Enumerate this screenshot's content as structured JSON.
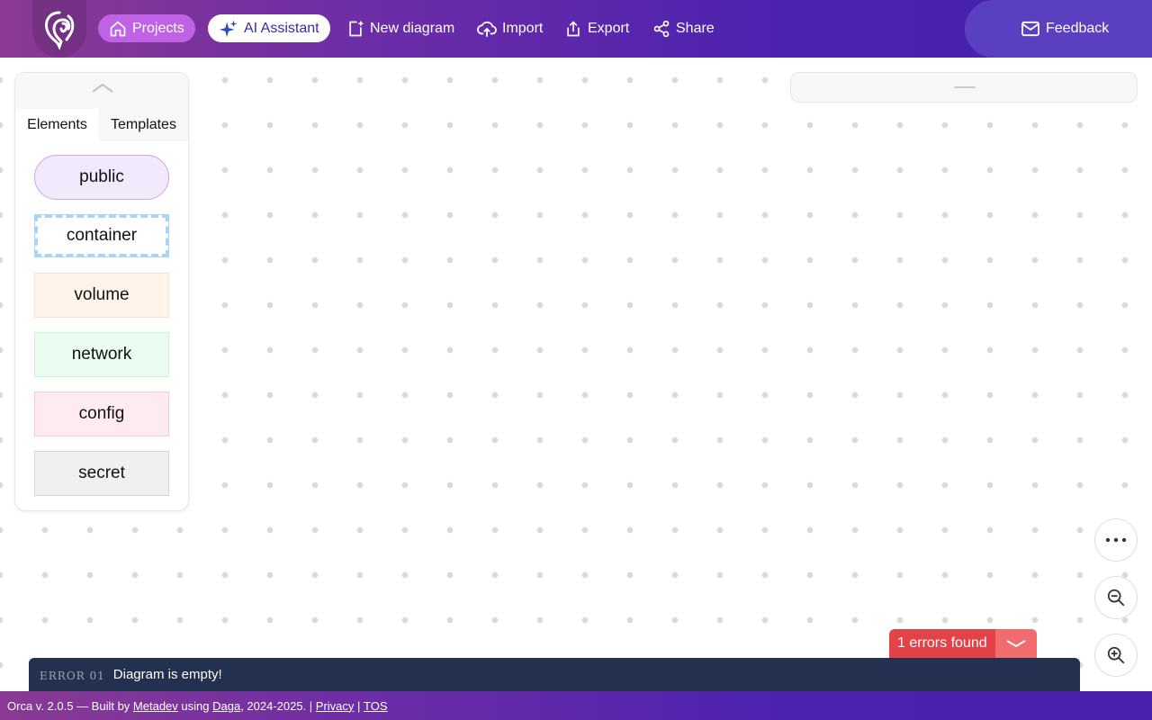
{
  "topbar": {
    "logo_icon": "ram-head-logo-icon",
    "projects_label": "Projects",
    "ai_label": "AI Assistant",
    "new_label": "New diagram",
    "import_label": "Import",
    "export_label": "Export",
    "share_label": "Share",
    "feedback_label": "Feedback"
  },
  "left_panel": {
    "tabs": [
      "Elements",
      "Templates"
    ],
    "active_tab": "Elements",
    "elements": [
      "public",
      "container",
      "volume",
      "network",
      "config",
      "secret"
    ]
  },
  "errors": {
    "badge": "1 errors found",
    "items": [
      {
        "code": "ERROR 01",
        "message": "Diagram is empty!"
      }
    ]
  },
  "footer": {
    "prefix": "Orca v. 2.0.5 — Built by ",
    "metadev": "Metadev",
    "using": " using ",
    "daga": "Daga",
    "years": ", 2024-2025. | ",
    "privacy": "Privacy",
    "sep": " | ",
    "tos": "TOS"
  },
  "colors": {
    "accent": "#c062e6",
    "header_start": "#8a3a93",
    "header_end": "#4a20ae",
    "error": "#e34348",
    "error_panel": "#24304f"
  }
}
